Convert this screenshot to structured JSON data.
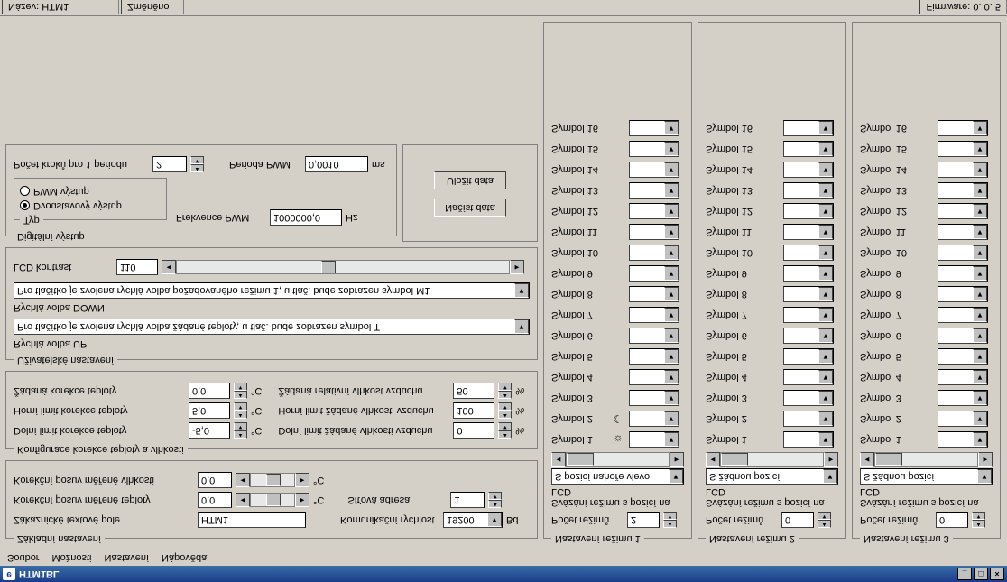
{
  "window": {
    "title": "HTM1BL",
    "min": "_",
    "max": "□",
    "close": "×"
  },
  "menu": [
    "Soubor",
    "Možnosti",
    "Nastavení",
    "Nápověda"
  ],
  "status": {
    "name_label": "Název: HTM1",
    "changed": "Změněno",
    "firmware_label": "Firmware:",
    "firmware_value": "0. 0. 5"
  },
  "basic": {
    "legend": "Základní nastavení",
    "cust_text_label": "Zákaznické textové pole",
    "cust_text_value": "HTM1",
    "baud_label": "Komunikační rychlost",
    "baud_value": "19200",
    "baud_unit": "Bd",
    "corr_temp_shift_label": "Korekční posuv měřené teploty",
    "corr_temp_shift_value": "0,0",
    "corr_hum_shift_label": "Korekční posuv měřené vlhkosti",
    "corr_hum_shift_value": "0,0",
    "addr_label": "Síťová adresa",
    "addr_value": "1",
    "deg": "°C"
  },
  "konf": {
    "legend": "Konfigurace korekce teploty a vlhkosti",
    "low_temp_label": "Dolní limit korekce teploty",
    "low_temp_value": "-5,0",
    "hi_temp_label": "Horní limit korekce teploty",
    "hi_temp_value": "5,0",
    "set_temp_label": "Žádaná korekce teploty",
    "set_temp_value": "0,0",
    "low_hum_label": "Dolní limit žádané vlhkosti vzduchu",
    "low_hum_value": "0",
    "hi_hum_label": "Horní limit žádané vlhkosti vzduchu",
    "hi_hum_value": "100",
    "set_hum_label": "Žádaná relativní vlhkost vzduchu",
    "set_hum_value": "50",
    "deg": "°C",
    "pct": "%"
  },
  "user": {
    "legend": "Uživatelské nastavení",
    "up_label": "Rychlá volba UP",
    "up_value": "Pro tlačítko je zvolena rychlá volba žádané teploty,  u tlač. bude zobrazen symbol T",
    "down_label": "Rychlá volba DOWN",
    "down_value": "Pro tlačítko je zvolena rychlá volba požadovaného režimu 1,  u tlač. bude zobrazen symbol M1",
    "lcd_label": "LCD kontrast",
    "lcd_value": "110"
  },
  "dig": {
    "legend": "Digitální výstup",
    "typ_legend": "Typ",
    "opt1": "Dvoustavový výstup",
    "opt2": "PWM výstup",
    "freq_label": "Frekvence PWM",
    "freq_value": "1000000,0",
    "freq_unit": "Hz",
    "steps_label": "Počet kroků pro 1 periodu",
    "steps_value": "2",
    "period_label": "Perioda PWM",
    "period_value": "0,0010",
    "period_unit": "ms"
  },
  "btns": {
    "load": "Načíst data",
    "save": "Uložit data"
  },
  "modes": [
    {
      "legend": "Nastavení režimu 1",
      "count_label": "Počet režimů",
      "count_value": "2",
      "bind_label": "Svázání režimu s pozicí na LCD",
      "bind_value": "S pozicí nahoře vlevo",
      "sym1_icon": "☼",
      "sym2_icon": "☾"
    },
    {
      "legend": "Nastavení režimu 2",
      "count_label": "Počet režimů",
      "count_value": "0",
      "bind_label": "Svázání režimu s pozicí na LCD",
      "bind_value": "S žádnou pozicí",
      "sym1_icon": "",
      "sym2_icon": ""
    },
    {
      "legend": "Nastavení režimu 3",
      "count_label": "Počet režimů",
      "count_value": "0",
      "bind_label": "Svázání režimu s pozicí na LCD",
      "bind_value": "S žádnou pozicí",
      "sym1_icon": "",
      "sym2_icon": ""
    }
  ],
  "symlabels": [
    "Symbol 1",
    "Symbol 2",
    "Symbol 3",
    "Symbol 4",
    "Symbol 5",
    "Symbol 6",
    "Symbol 7",
    "Symbol 8",
    "Symbol 9",
    "Symbol 10",
    "Symbol 11",
    "Symbol 12",
    "Symbol 13",
    "Symbol 14",
    "Symbol 15",
    "Symbol 16"
  ]
}
